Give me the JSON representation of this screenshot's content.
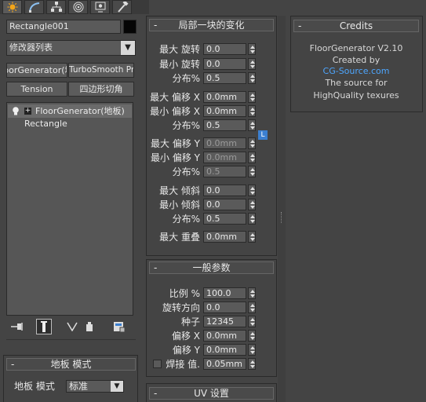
{
  "tabs": [
    {
      "name": "create",
      "icon": "sun-icon"
    },
    {
      "name": "modify",
      "icon": "curve-icon"
    },
    {
      "name": "hierarchy",
      "icon": "hierarchy-icon"
    },
    {
      "name": "motion",
      "icon": "motion-icon"
    },
    {
      "name": "display",
      "icon": "display-icon"
    },
    {
      "name": "utilities",
      "icon": "hammer-icon"
    }
  ],
  "object": {
    "name": "Rectangle001",
    "color": "#050505"
  },
  "modifier_list": {
    "label": "修改器列表",
    "arrow": "▼"
  },
  "modifier_buttons": [
    "FloorGenerator(地板)",
    "TurboSmooth Pro",
    "Tension",
    "四边形切角"
  ],
  "modifier_stack": {
    "items": [
      {
        "label": "FloorGenerator(地板)",
        "selected": true,
        "expander": "+"
      },
      {
        "label": "Rectangle",
        "selected": false
      }
    ]
  },
  "floor_mode": {
    "title": "地板 模式",
    "label": "地板 模式",
    "value": "标准",
    "arrow": "▼"
  },
  "local_rollout": {
    "title": "局部一块的变化",
    "collapse": "-",
    "rows": [
      {
        "label": "最大 旋转",
        "value": "0.0",
        "dim": false
      },
      {
        "label": "最小 旋转",
        "value": "0.0",
        "dim": false
      },
      {
        "label": "分布%",
        "value": "0.5",
        "dim": false
      },
      {
        "label": "最大 偏移 X",
        "value": "0.0mm",
        "dim": false
      },
      {
        "label": "最小 偏移 X",
        "value": "0.0mm",
        "dim": false
      },
      {
        "label": "分布%",
        "value": "0.5",
        "dim": false
      },
      {
        "label": "最大 偏移 Y",
        "value": "0.0mm",
        "dim": true
      },
      {
        "label": "最小 偏移 Y",
        "value": "0.0mm",
        "dim": true
      },
      {
        "label": "分布%",
        "value": "0.5",
        "dim": true
      },
      {
        "label": "最大 倾斜",
        "value": "0.0",
        "dim": false
      },
      {
        "label": "最小 倾斜",
        "value": "0.0",
        "dim": false
      },
      {
        "label": "分布%",
        "value": "0.5",
        "dim": false
      },
      {
        "label": "最大 重叠",
        "value": "0.0mm",
        "dim": false
      }
    ],
    "lock_label": "L"
  },
  "general_rollout": {
    "title": "一般参数",
    "collapse": "-",
    "rows": [
      {
        "label": "比例 %",
        "value": "100.0"
      },
      {
        "label": "旋转方向",
        "value": "0.0"
      },
      {
        "label": "种子",
        "value": "12345"
      },
      {
        "label": "偏移 X",
        "value": "0.0mm"
      },
      {
        "label": "偏移 Y",
        "value": "0.0mm"
      },
      {
        "label": "焊接 值.",
        "value": "0.05mm",
        "checkbox": true
      }
    ]
  },
  "uv_rollout": {
    "title": "UV 设置",
    "collapse": "-"
  },
  "credits": {
    "title": "Credits",
    "collapse": "-",
    "lines": [
      "FloorGenerator V2.10",
      "Created by",
      "CG-Source.com",
      "The source for",
      "HighQuality texures"
    ],
    "link_index": 2,
    "link_color": "#4da6ff"
  }
}
